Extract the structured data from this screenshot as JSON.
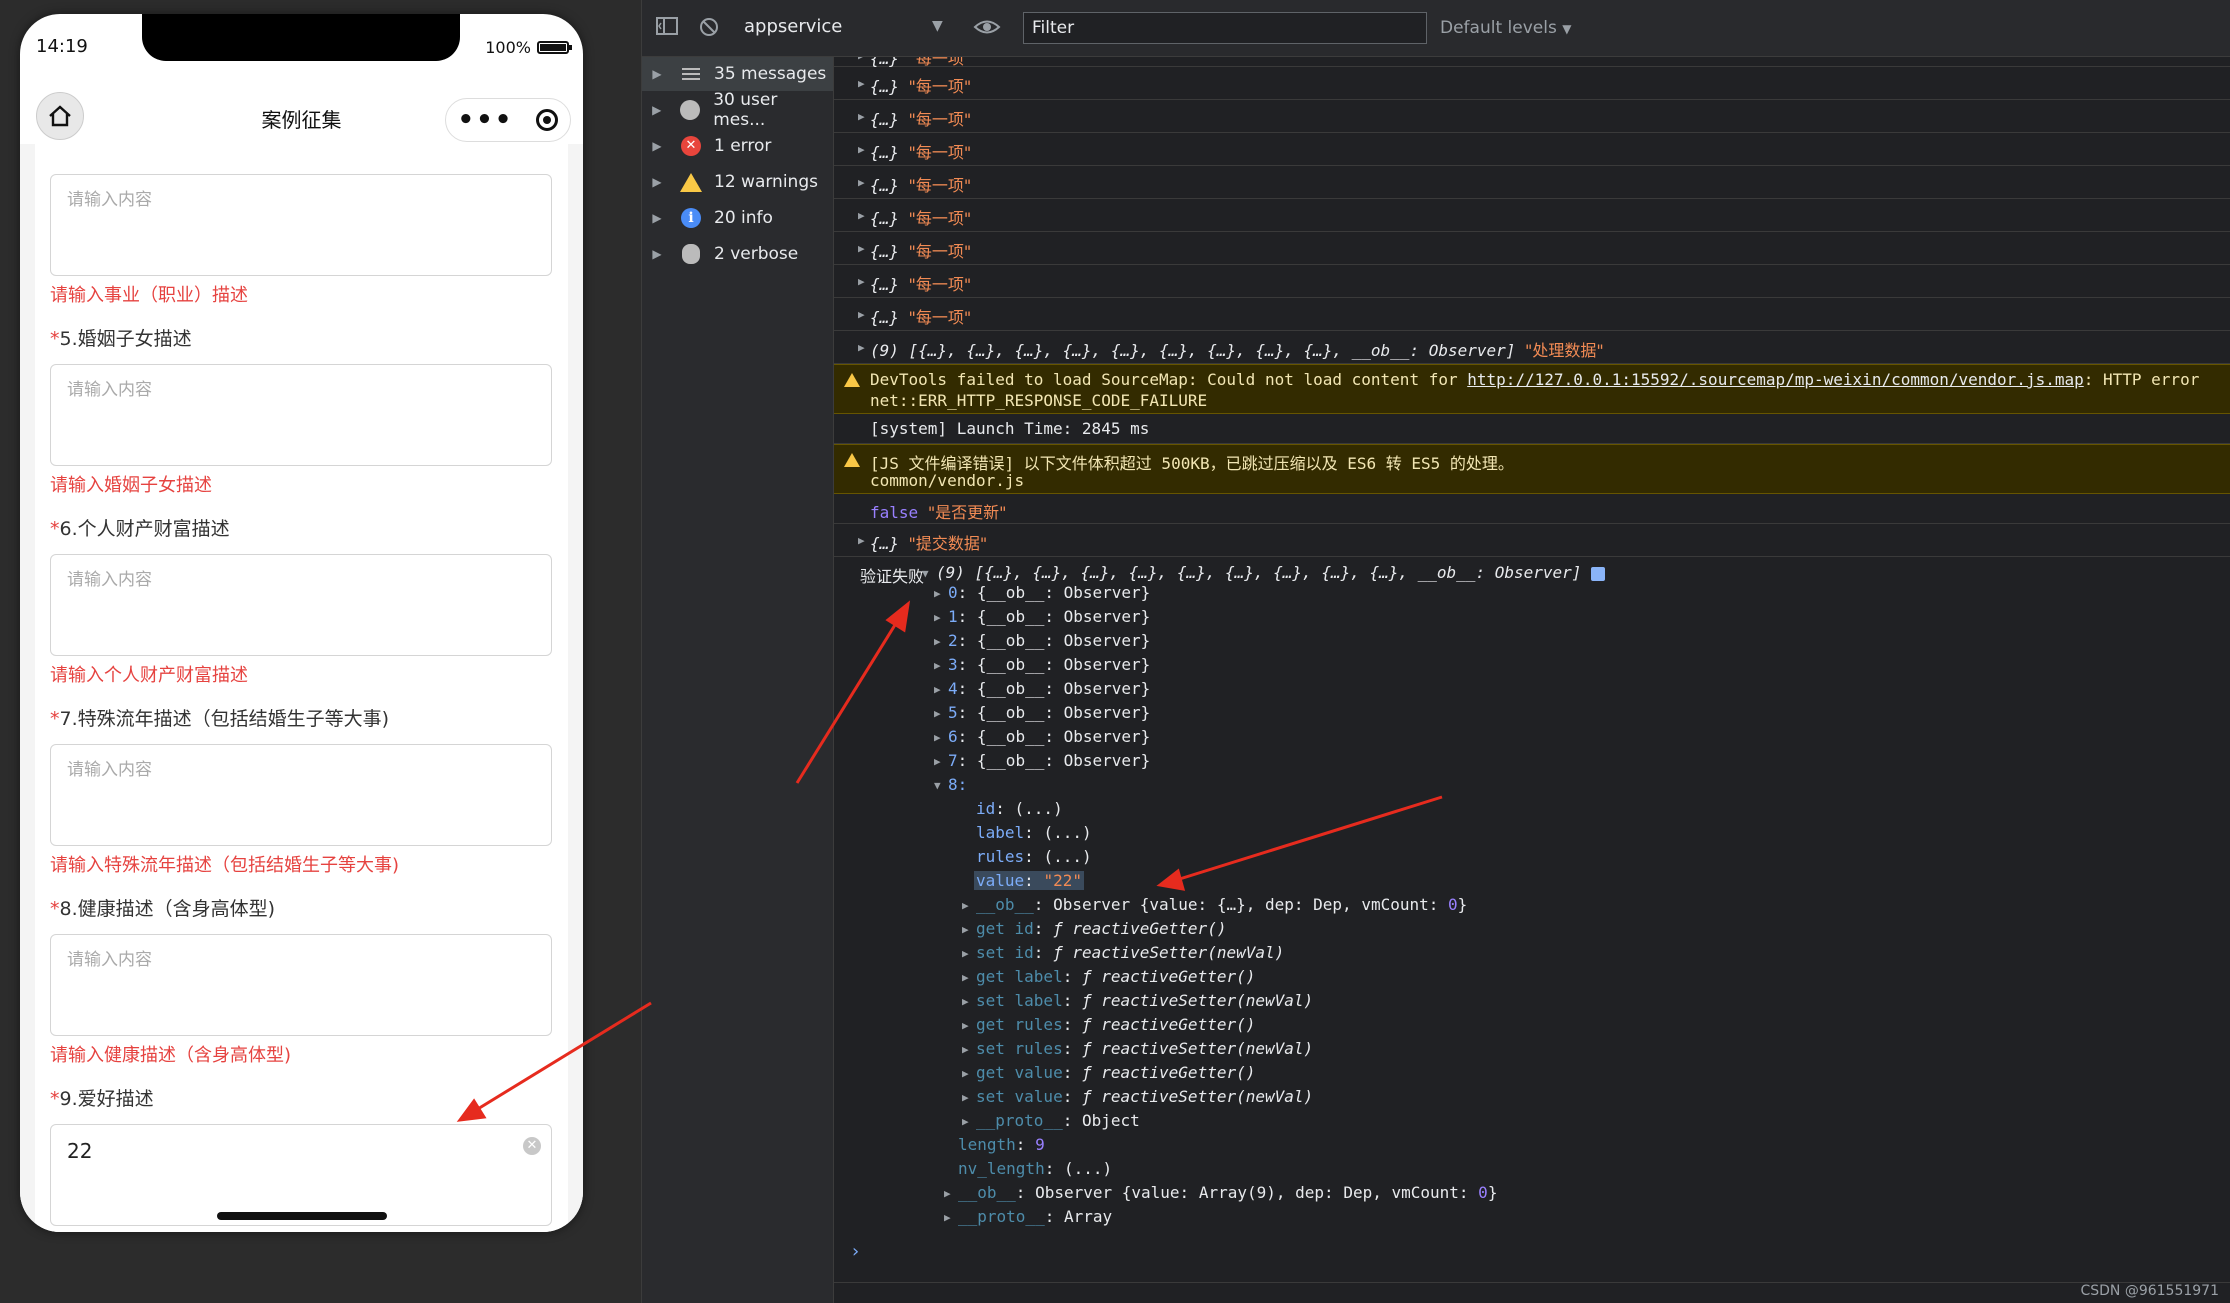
{
  "phone": {
    "status_time": "14:19",
    "status_battery": "100%",
    "nav_title": "案例征集",
    "fields": [
      {
        "placeholder": "请输入内容",
        "error": "请输入事业（职业）描述"
      },
      {
        "label": "5.婚姻子女描述",
        "placeholder": "请输入内容",
        "error": "请输入婚姻子女描述"
      },
      {
        "label": "6.个人财产财富描述",
        "placeholder": "请输入内容",
        "error": "请输入个人财产财富描述"
      },
      {
        "label": "7.特殊流年描述（包括结婚生子等大事)",
        "placeholder": "请输入内容",
        "error": "请输入特殊流年描述（包括结婚生子等大事)"
      },
      {
        "label": "8.健康描述（含身高体型)",
        "placeholder": "请输入内容",
        "error": "请输入健康描述（含身高体型)"
      },
      {
        "label": "9.爱好描述",
        "value": "22"
      }
    ],
    "required_mark": "*"
  },
  "toolbar": {
    "context": "appservice",
    "filter_placeholder": "Filter",
    "levels": "Default levels"
  },
  "sidebar": {
    "items": [
      {
        "label": "35 messages",
        "icon": "list-icon"
      },
      {
        "label": "30 user mes...",
        "icon": "user-icon"
      },
      {
        "label": "1 error",
        "icon": "error-icon"
      },
      {
        "label": "12 warnings",
        "icon": "warning-icon"
      },
      {
        "label": "20 info",
        "icon": "info-icon"
      },
      {
        "label": "2 verbose",
        "icon": "bug-icon"
      }
    ]
  },
  "console": {
    "item_obj": "{…}",
    "item_label": "\"每一项\"",
    "array9": "(9) [{…}, {…}, {…}, {…}, {…}, {…}, {…}, {…}, {…}, __ob__: Observer]",
    "array9_label": "\"处理数据\"",
    "warn1_prefix": "DevTools failed to load SourceMap: Could not load content for ",
    "warn1_link": "http://127.0.0.1:15592/.sourcemap/mp-weixin/common/vendor.js.map",
    "warn1_suffix": ": HTTP error",
    "warn1_line2": "net::ERR_HTTP_RESPONSE_CODE_FAILURE",
    "launch": "[system] Launch Time: 2845 ms",
    "warn2_line1": "[JS 文件编译错误] 以下文件体积超过 500KB，已跳过压缩以及 ES6 转 ES5 的处理。",
    "warn2_line2": "common/vendor.js",
    "false_kw": "false",
    "false_label": "\"是否更新\"",
    "submit_label": "\"提交数据\"",
    "fail_label": "验证失败",
    "observer_item": "{__ob__: Observer}",
    "idx8": "8:",
    "id_line": ": (...)",
    "value_val": "\"22\"",
    "ob_line": ": Observer {value: {…}, dep: Dep, vmCount: ",
    "zero": "0",
    "getter": "ƒ reactiveGetter()",
    "setter": "ƒ reactiveSetter(newVal)",
    "proto_object": ": Object",
    "length_val": "9",
    "nv_length_val": ": (...)",
    "ob_array": ": Observer {value: Array(9), dep: Dep, vmCount: ",
    "proto_array": ": Array",
    "prompt": "›"
  },
  "watermark": "CSDN @961551971",
  "colors": {
    "error_red": "#e64340",
    "arrow_red": "#e62b1e",
    "console_bg": "#202124",
    "warning_bg": "#332b00"
  }
}
